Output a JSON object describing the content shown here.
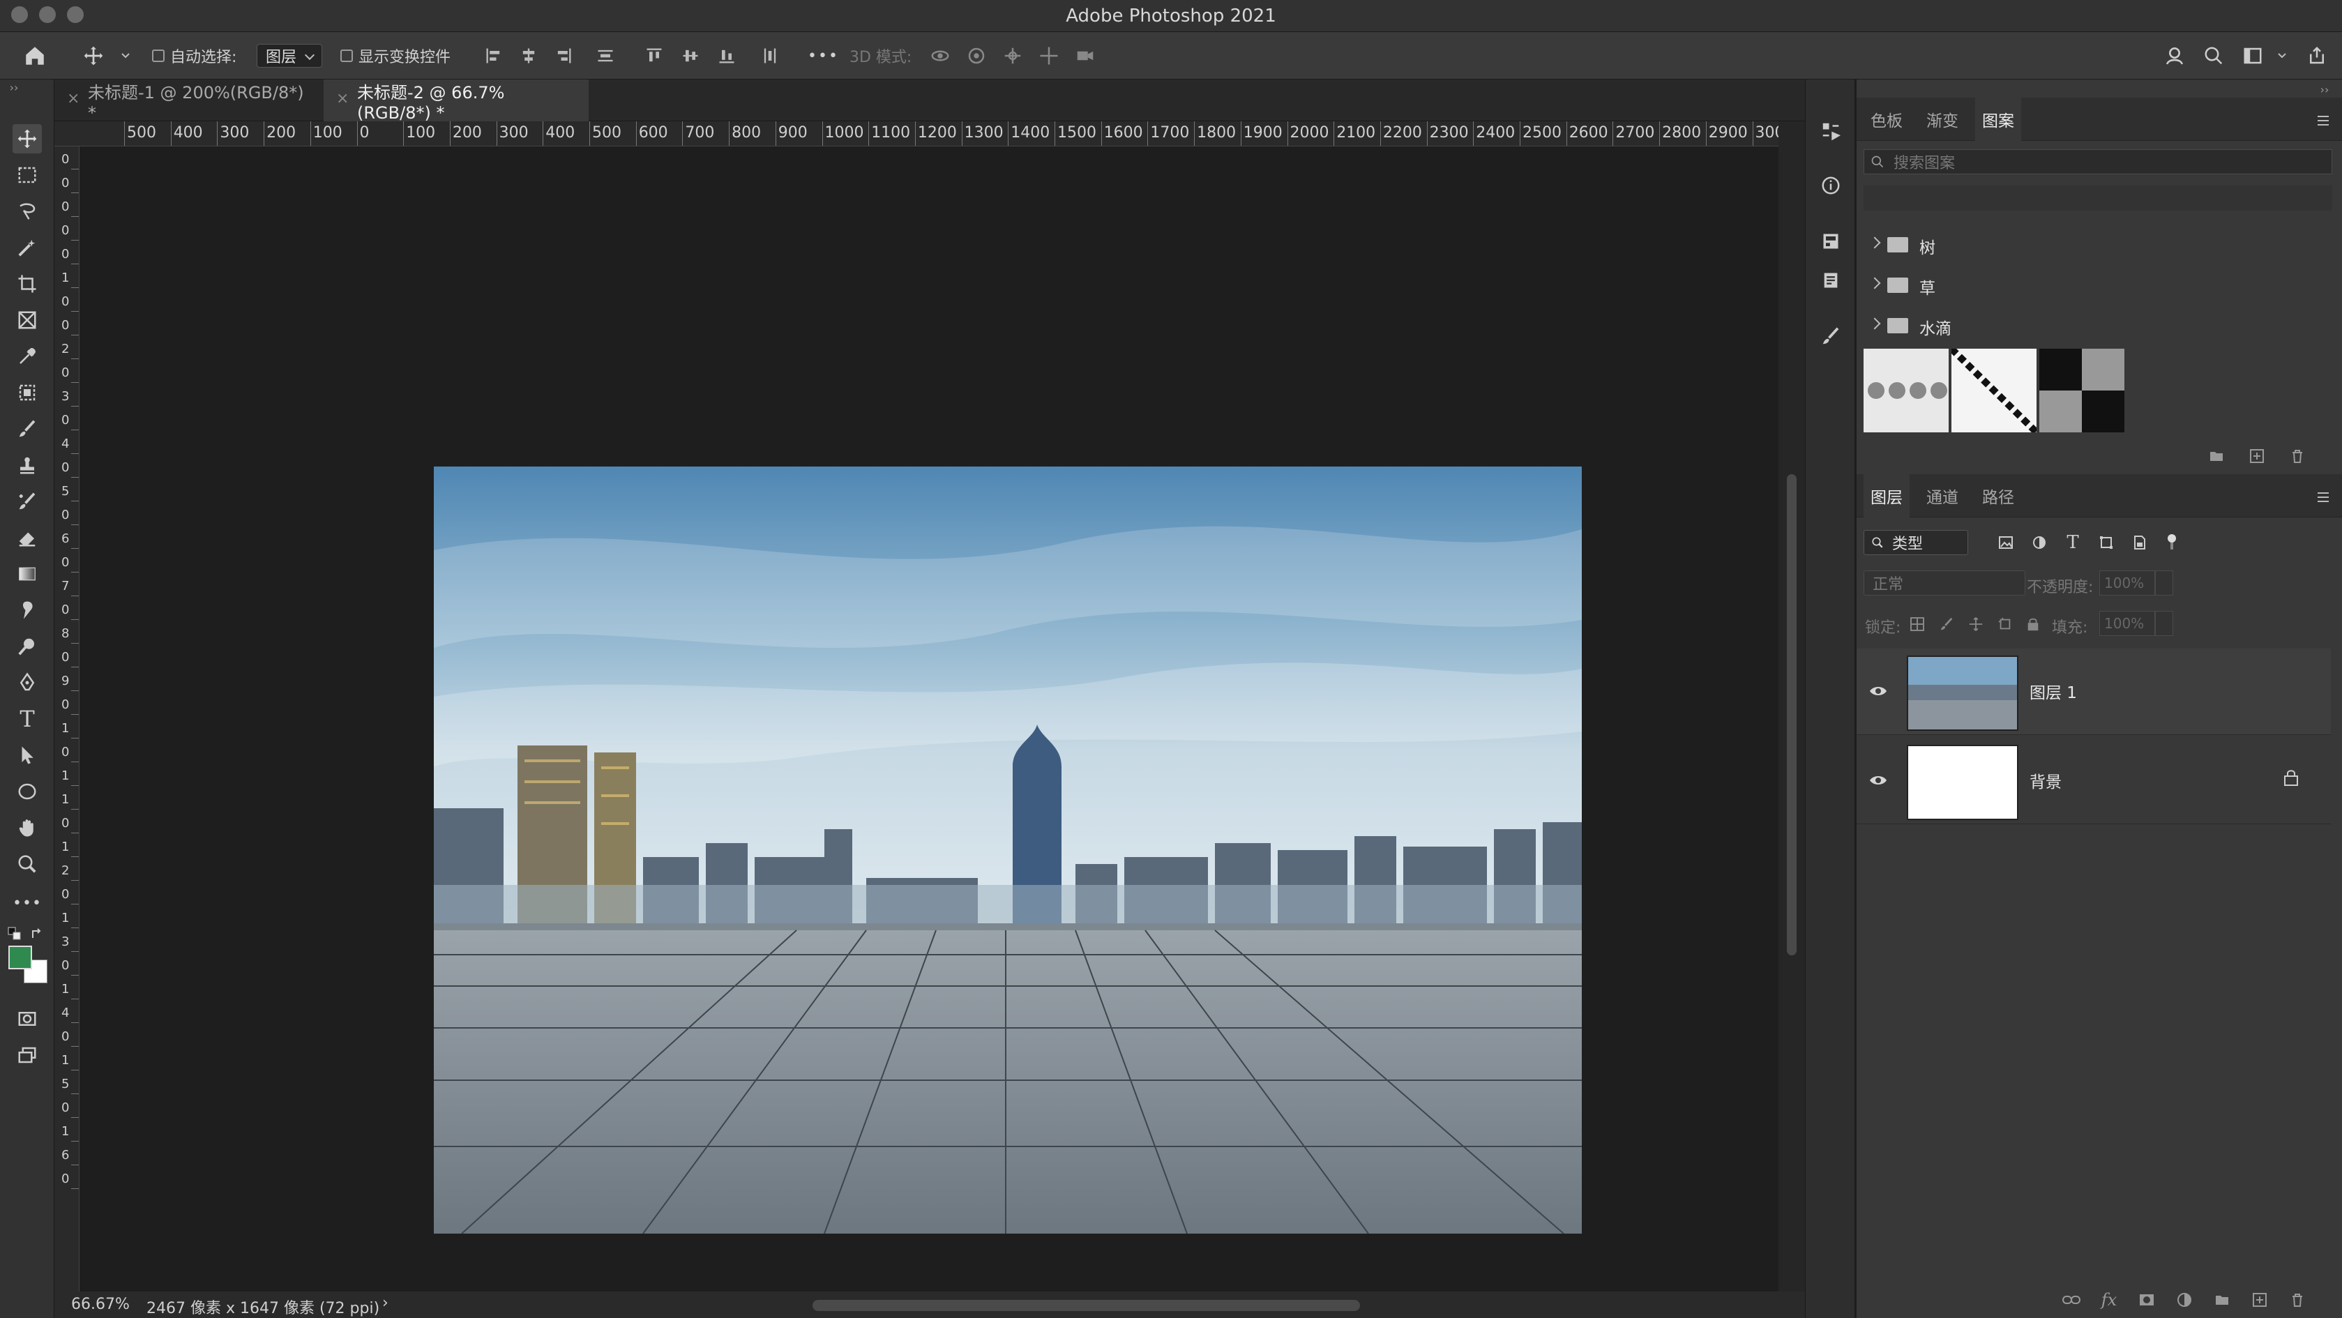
{
  "app": {
    "title": "Adobe Photoshop 2021"
  },
  "options": {
    "auto_select_label": "自动选择:",
    "auto_select_target": "图层",
    "show_transform_label": "显示变换控件",
    "mode3d_label": "3D 模式:",
    "more": "•••"
  },
  "tabs": [
    {
      "label": "未标题-1 @ 200%(RGB/8*) *"
    },
    {
      "label": "未标题-2 @ 66.7%(RGB/8*) *"
    }
  ],
  "rulers": {
    "top_labels": [
      "500",
      "400",
      "300",
      "200",
      "100",
      "0",
      "100",
      "200",
      "300",
      "400",
      "500",
      "600",
      "700",
      "800",
      "900",
      "1000",
      "1100",
      "1200",
      "1300",
      "1400",
      "1500",
      "1600",
      "1700",
      "1800",
      "1900",
      "2000",
      "2100",
      "2200",
      "2300",
      "2400",
      "2500",
      "2600",
      "2700",
      "2800",
      "2900",
      "300"
    ],
    "left_labels": [
      "0",
      "0",
      "0",
      "0",
      "0",
      "1",
      "0",
      "0",
      "2",
      "0",
      "3",
      "0",
      "4",
      "0",
      "5",
      "0",
      "6",
      "0",
      "7",
      "0",
      "8",
      "0",
      "9",
      "0",
      "1",
      "0",
      "1",
      "1",
      "0",
      "1",
      "2",
      "0",
      "1",
      "3",
      "0",
      "1",
      "4",
      "0",
      "1",
      "5",
      "0",
      "1",
      "6",
      "0"
    ]
  },
  "status": {
    "zoom": "66.67%",
    "doc_info": "2467 像素 x 1647 像素 (72 ppi)",
    "arrow": "›"
  },
  "patterns_panel": {
    "tabs": [
      "色板",
      "渐变",
      "图案"
    ],
    "search_placeholder": "搜索图案",
    "groups": [
      "树",
      "草",
      "水滴"
    ]
  },
  "layers_panel": {
    "tabs": [
      "图层",
      "通道",
      "路径"
    ],
    "filter_label": "类型",
    "blend_mode": "正常",
    "opacity_label": "不透明度:",
    "opacity_value": "100%",
    "lock_label": "锁定:",
    "fill_label": "填充:",
    "fill_value": "100%",
    "layers": [
      {
        "name": "图层 1",
        "visible": true
      },
      {
        "name": "背景",
        "visible": true,
        "locked": true
      }
    ]
  },
  "colors": {
    "foreground": "#2e8a4f",
    "background": "#ffffff",
    "accent": "#4a9cff"
  },
  "icons": [
    "home-icon",
    "move-icon",
    "marquee-icon",
    "lasso-icon",
    "magic-wand-icon",
    "crop-icon",
    "frame-icon",
    "eyedropper-icon",
    "patch-icon",
    "brush-icon",
    "stamp-icon",
    "history-brush-icon",
    "eraser-icon",
    "gradient-icon",
    "smudge-icon",
    "dodge-icon",
    "pen-icon",
    "type-icon",
    "path-select-icon",
    "ellipse-icon",
    "hand-icon",
    "zoom-icon",
    "search-icon",
    "eye-icon",
    "lock-icon",
    "folder-icon"
  ]
}
